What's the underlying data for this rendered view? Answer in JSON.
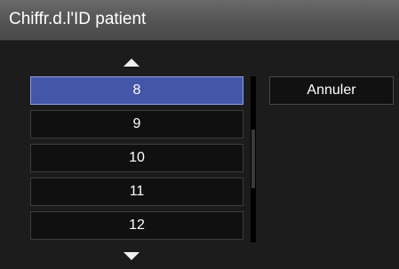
{
  "dialog": {
    "title": "Chiffr.d.l'ID patient"
  },
  "list": {
    "items": [
      "8",
      "9",
      "10",
      "11",
      "12"
    ],
    "selected_index": 0
  },
  "buttons": {
    "cancel_label": "Annuler"
  },
  "icons": {
    "scroll_up": "triangle-up-icon",
    "scroll_down": "triangle-down-icon"
  },
  "colors": {
    "selected": "#4356a8",
    "title_bar": "#555555",
    "background": "#1c1c1c"
  }
}
